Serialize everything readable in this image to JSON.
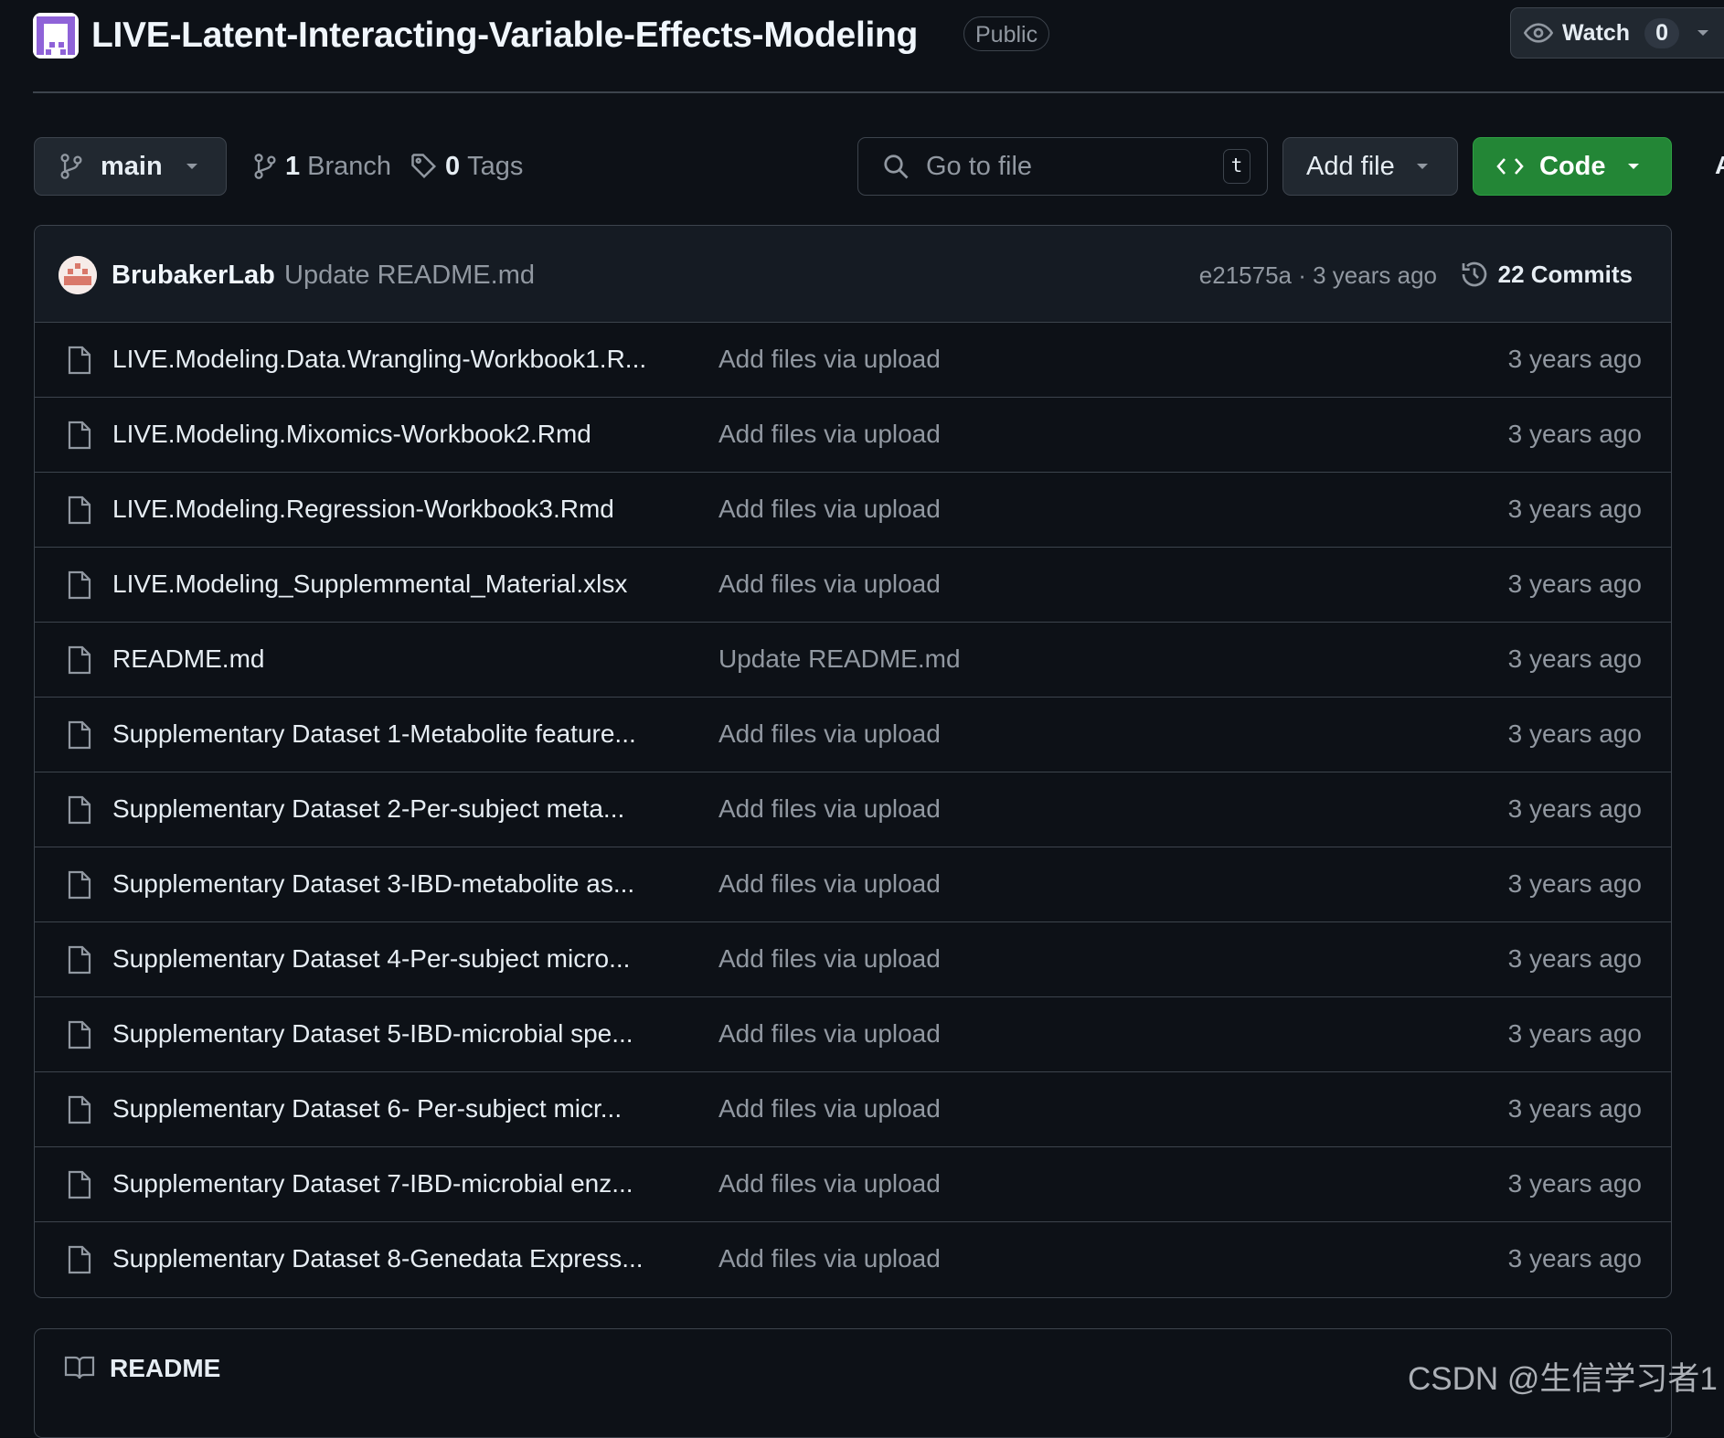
{
  "header": {
    "repo_name": "LIVE-Latent-Interacting-Variable-Effects-Modeling",
    "visibility": "Public",
    "watch_label": "Watch",
    "watch_count": "0"
  },
  "toolbar": {
    "branch": "main",
    "branches_count": "1",
    "branches_label": "Branch",
    "tags_count": "0",
    "tags_label": "Tags",
    "search_placeholder": "Go to file",
    "search_shortcut": "t",
    "add_file_label": "Add file",
    "code_label": "Code"
  },
  "latest_commit": {
    "author": "BrubakerLab",
    "message": "Update README.md",
    "hash_time": "e21575a · 3 years ago",
    "commits_label": "22 Commits"
  },
  "files": [
    {
      "name": "LIVE.Modeling.Data.Wrangling-Workbook1.R...",
      "message": "Add files via upload",
      "time": "3 years ago"
    },
    {
      "name": "LIVE.Modeling.Mixomics-Workbook2.Rmd",
      "message": "Add files via upload",
      "time": "3 years ago"
    },
    {
      "name": "LIVE.Modeling.Regression-Workbook3.Rmd",
      "message": "Add files via upload",
      "time": "3 years ago"
    },
    {
      "name": "LIVE.Modeling_Supplemmental_Material.xlsx",
      "message": "Add files via upload",
      "time": "3 years ago"
    },
    {
      "name": "README.md",
      "message": "Update README.md",
      "time": "3 years ago"
    },
    {
      "name": "Supplementary Dataset 1-Metabolite feature...",
      "message": "Add files via upload",
      "time": "3 years ago"
    },
    {
      "name": "Supplementary Dataset 2-Per-subject meta...",
      "message": "Add files via upload",
      "time": "3 years ago"
    },
    {
      "name": "Supplementary Dataset 3-IBD-metabolite as...",
      "message": "Add files via upload",
      "time": "3 years ago"
    },
    {
      "name": "Supplementary Dataset 4-Per-subject micro...",
      "message": "Add files via upload",
      "time": "3 years ago"
    },
    {
      "name": "Supplementary Dataset 5-IBD-microbial spe...",
      "message": "Add files via upload",
      "time": "3 years ago"
    },
    {
      "name": "Supplementary Dataset 6- Per-subject micr...",
      "message": "Add files via upload",
      "time": "3 years ago"
    },
    {
      "name": "Supplementary Dataset 7-IBD-microbial enz...",
      "message": "Add files via upload",
      "time": "3 years ago"
    },
    {
      "name": "Supplementary Dataset 8-Genedata Express...",
      "message": "Add files via upload",
      "time": "3 years ago"
    }
  ],
  "readme": {
    "title": "README"
  },
  "watermark": "CSDN @生信学习者1",
  "colors": {
    "background": "#0d1117",
    "border": "#3d444d",
    "code_button": "#238636",
    "muted_text": "#9198a1",
    "text": "#e6edf3"
  },
  "icons": {
    "branch": "git-branch-icon",
    "tag": "tag-icon",
    "search": "search-icon",
    "code": "code-icon",
    "history": "history-icon",
    "file": "file-icon",
    "readme": "book-icon",
    "watch": "eye-icon"
  }
}
